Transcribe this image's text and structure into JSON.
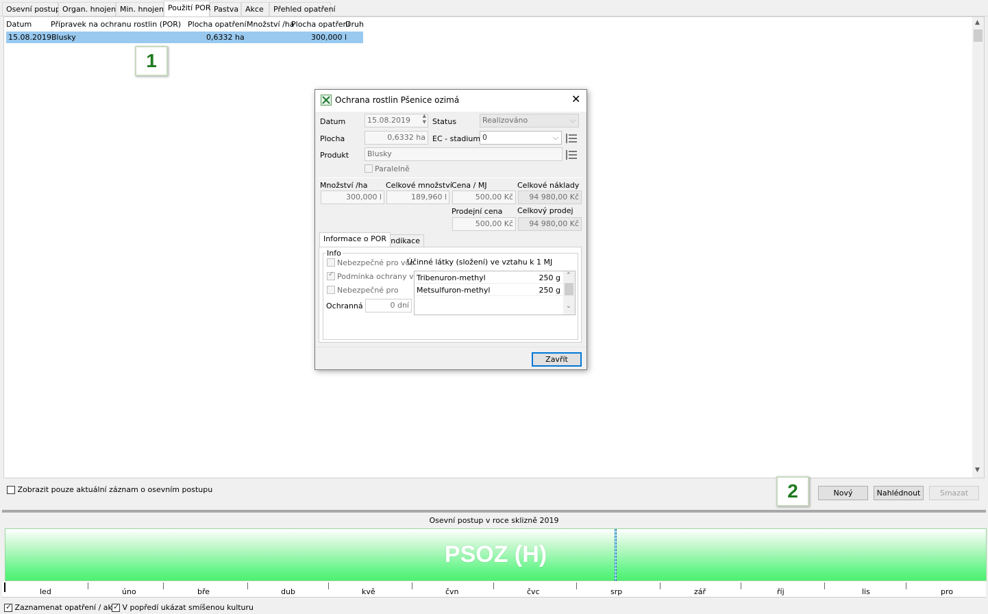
{
  "tabs": [
    {
      "label": "Osevní postup"
    },
    {
      "label": "Organ. hnojení"
    },
    {
      "label": "Min. hnojení"
    },
    {
      "label": "Použití POR"
    },
    {
      "label": "Pastva"
    },
    {
      "label": "Akce"
    },
    {
      "label": "Přehled opatření"
    }
  ],
  "table": {
    "columns": [
      "Datum",
      "Přípravek na ochranu rostlin (POR)",
      "Plocha opatření",
      "Množství /ha",
      "Plocha opatření",
      "Druh"
    ],
    "rows": [
      {
        "date": "15.08.2019",
        "product": "Blusky",
        "area": "0,6332 ha",
        "amount": "300,000 l"
      }
    ]
  },
  "badges": {
    "one": "1",
    "two": "2"
  },
  "bottom": {
    "only_current_label": "Zobrazit pouze aktuální záznam o osevním postupu",
    "btn_new": "Nový",
    "btn_view": "Nahlédnout",
    "btn_delete": "Smazat"
  },
  "timeline": {
    "title": "Osevní postup v roce sklizně 2019",
    "crop": "PSOZ (H)",
    "months": [
      "led",
      "úno",
      "bře",
      "dub",
      "kvě",
      "čvn",
      "čvc",
      "srp",
      "zář",
      "říj",
      "lis",
      "pro"
    ]
  },
  "footer": {
    "record_label": "Zaznamenat opatření / akci",
    "mixed_label": "V popředí ukázat smíšenou kulturu"
  },
  "dialog": {
    "title": "Ochrana rostlin Pšenice ozimá",
    "date_label": "Datum",
    "date_value": "15.08.2019",
    "status_label": "Status",
    "status_value": "Realizováno",
    "area_label": "Plocha",
    "area_value": "0,6332 ha",
    "ec_label": "EC - stadium",
    "ec_value": "0",
    "product_label": "Produkt",
    "product_value": "Blusky",
    "parallel_label": "Paralelně",
    "amount_label": "Množství /ha",
    "amount_value": "300,000 l",
    "total_amount_label": "Celkové množství",
    "total_amount_value": "189,960 l",
    "price_label": "Cena / MJ",
    "price_value": "500,00 Kč",
    "total_cost_label": "Celkové náklady",
    "total_cost_value": "94 980,00 Kč",
    "sale_price_label": "Prodejní cena",
    "sale_price_value": "500,00 Kč",
    "total_sale_label": "Celkový prodej",
    "total_sale_value": "94 980,00 Kč",
    "subtab_info": "Informace o POR",
    "subtab_indication": "Indikace",
    "group_label": "Info",
    "chk_dangerous_bees": "Nebezpečné pro vče",
    "chk_water_protection": "Podmínka ochrany voc",
    "chk_dangerous": "Nebezpečné pro",
    "protect_label": "Ochranná lh",
    "protect_value": "0 dní",
    "ingredients_label": "Účinné látky (složení) ve vztahu k 1 MJ",
    "ingredients": [
      {
        "name": "Tribenuron-methyl",
        "qty": "250 g"
      },
      {
        "name": "Metsulfuron-methyl",
        "qty": "250 g"
      }
    ],
    "close_label": "Zavřít"
  }
}
